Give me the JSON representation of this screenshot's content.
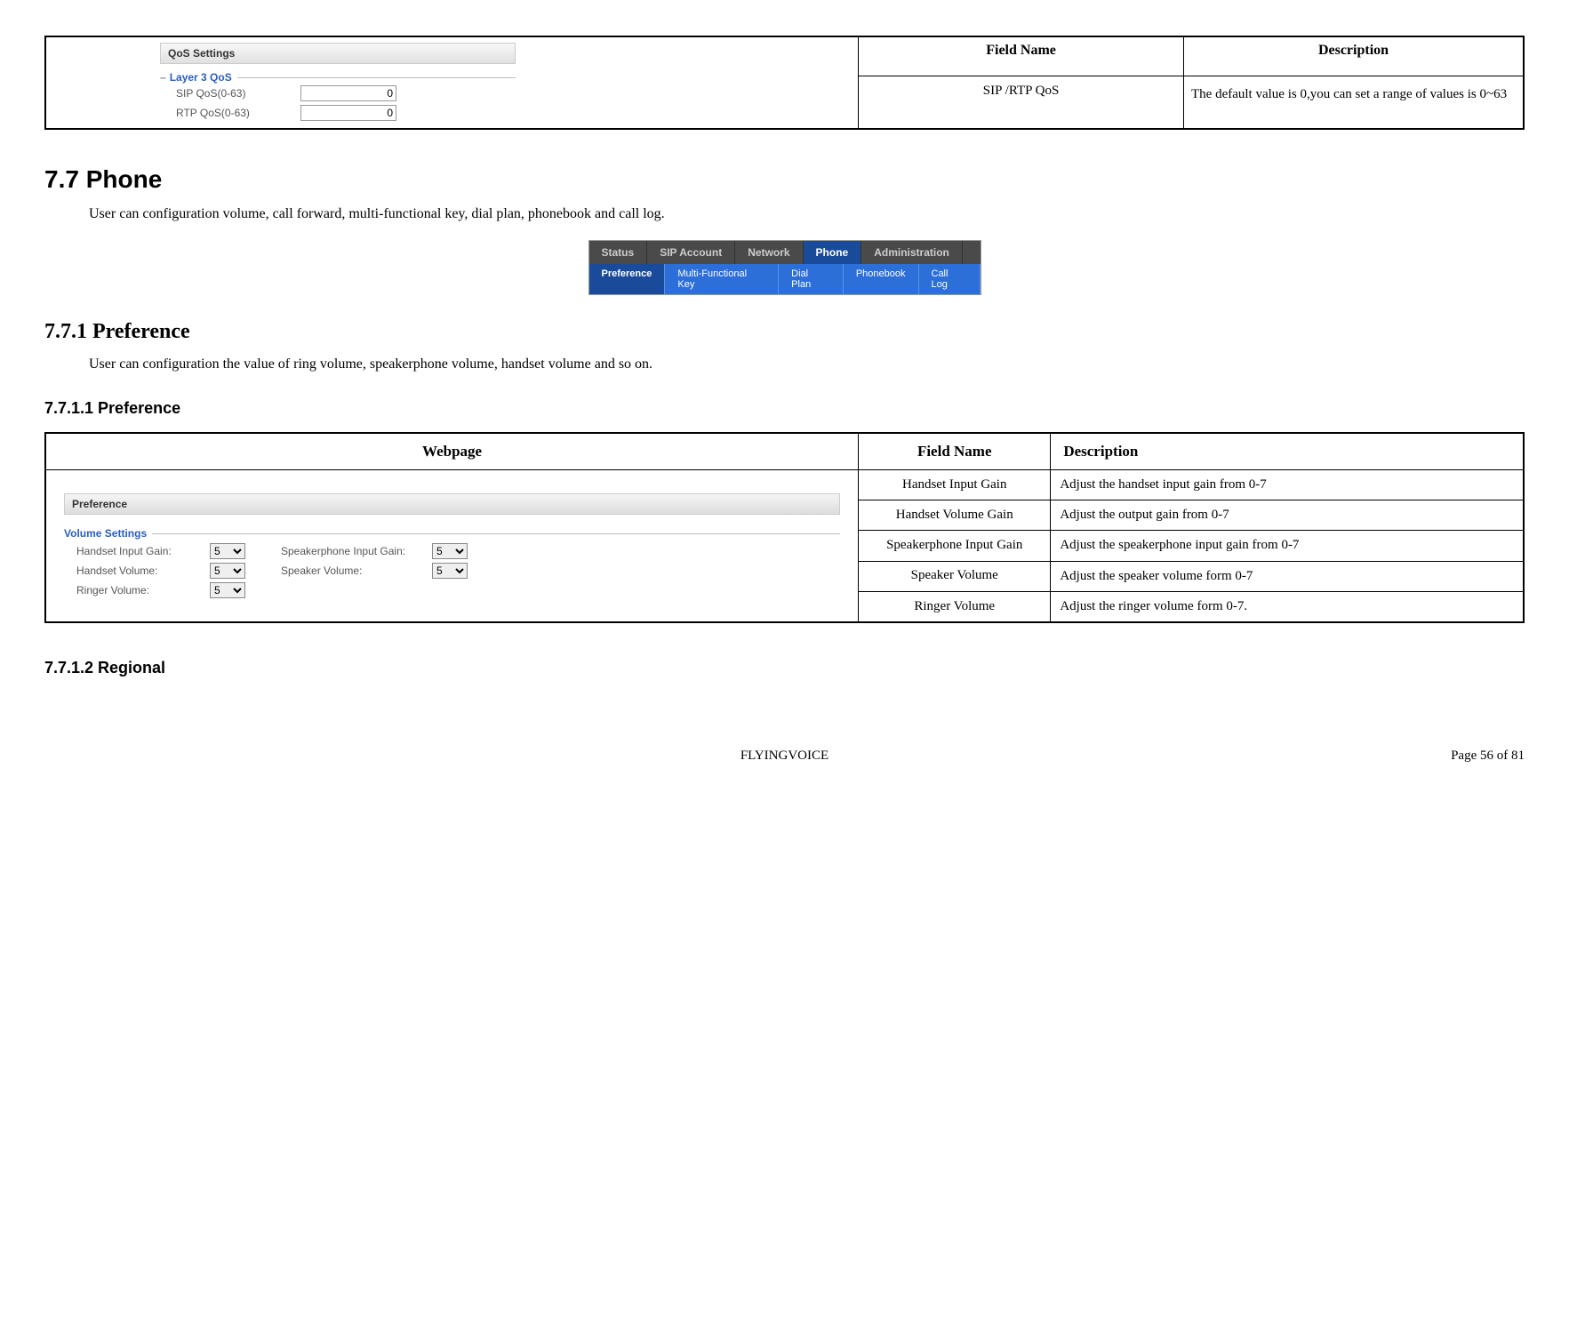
{
  "qos": {
    "panel_title": "QoS Settings",
    "fieldset": "Layer 3 QoS",
    "sip_label": "SIP QoS(0-63)",
    "sip_value": "0",
    "rtp_label": "RTP QoS(0-63)",
    "rtp_value": "0",
    "th_field": "Field Name",
    "th_desc": "Description",
    "row_field": "SIP /RTP QoS",
    "row_desc": "The default value is 0,you can set a range of values is 0~63"
  },
  "sec77": {
    "heading": "7.7   Phone",
    "body": "User can configuration volume, call forward, multi-functional key, dial plan, phonebook and call log."
  },
  "tabs": {
    "row1": [
      "Status",
      "SIP Account",
      "Network",
      "Phone",
      "Administration"
    ],
    "active1": "Phone",
    "row2": [
      "Preference",
      "Multi-Functional Key",
      "Dial Plan",
      "Phonebook",
      "Call Log"
    ],
    "active2": "Preference"
  },
  "sec771": {
    "heading": "7.7.1     Preference",
    "body": "User can configuration the value of ring volume, speakerphone volume, handset volume and so on."
  },
  "sec7711": {
    "heading": "7.7.1.1  Preference"
  },
  "pref_table": {
    "th_web": "Webpage",
    "th_field": "Field Name",
    "th_desc": "Description",
    "panel_title": "Preference",
    "vol_title": "Volume Settings",
    "fields": {
      "hig_label": "Handset Input Gain:",
      "hv_label": "Handset Volume:",
      "rv_label": "Ringer Volume:",
      "sig_label": "Speakerphone Input Gain:",
      "sv_label": "Speaker Volume:",
      "value": "5"
    },
    "rows": [
      {
        "field": "Handset Input Gain",
        "desc": "Adjust the handset input gain from 0-7"
      },
      {
        "field": "Handset Volume Gain",
        "desc": "Adjust the output gain from 0-7"
      },
      {
        "field": "Speakerphone Input Gain",
        "desc": "Adjust the speakerphone input gain from 0-7"
      },
      {
        "field": "Speaker Volume",
        "desc": "Adjust the speaker volume form 0-7"
      },
      {
        "field": "Ringer Volume",
        "desc": "Adjust the ringer volume form 0-7."
      }
    ]
  },
  "sec7712": {
    "heading": "7.7.1.2  Regional"
  },
  "footer": {
    "center": "FLYINGVOICE",
    "right": "Page  56  of  81"
  }
}
